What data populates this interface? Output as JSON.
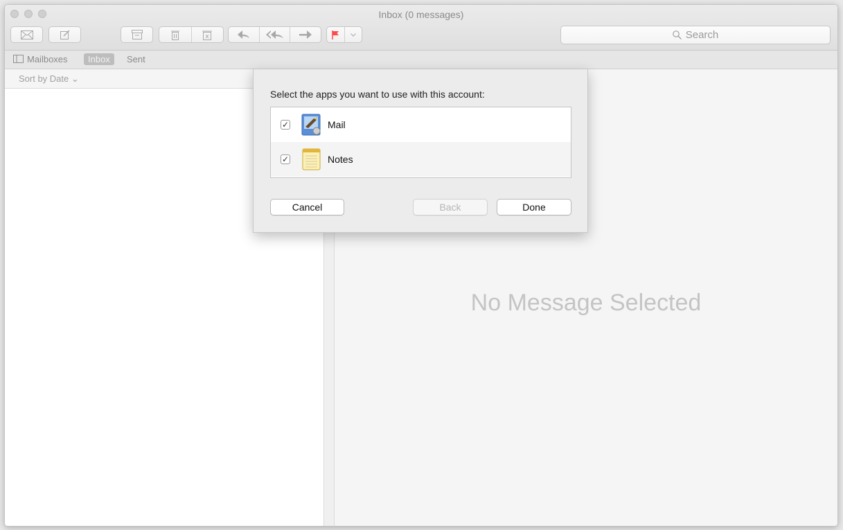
{
  "window": {
    "title": "Inbox (0 messages)"
  },
  "toolbar": {
    "buttons": [
      "get-mail",
      "compose",
      "archive",
      "delete",
      "junk",
      "reply",
      "reply-all",
      "forward",
      "flag",
      "flag-menu"
    ],
    "flag_color": "#ff4a4a",
    "icon_color": "#a8a8a8"
  },
  "search": {
    "placeholder": "Search"
  },
  "favorites": {
    "mailboxes": "Mailboxes",
    "inbox": "Inbox",
    "sent": "Sent"
  },
  "sort": {
    "label": "Sort by Date ⌄"
  },
  "viewer": {
    "empty": "No Message Selected"
  },
  "dialog": {
    "prompt": "Select the apps you want to use with this account:",
    "apps": [
      {
        "name": "Mail",
        "checked": true,
        "icon": "mail-app-icon"
      },
      {
        "name": "Notes",
        "checked": true,
        "icon": "notes-app-icon"
      }
    ],
    "cancel": "Cancel",
    "back": "Back",
    "done": "Done"
  }
}
